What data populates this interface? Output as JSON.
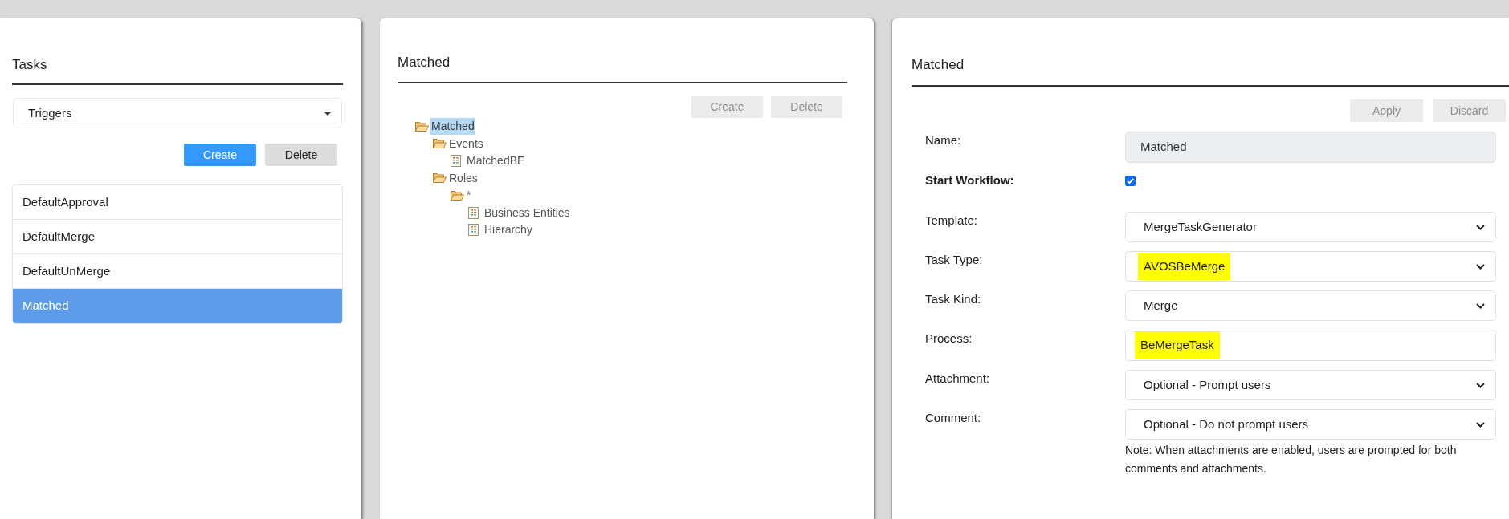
{
  "tasks_panel": {
    "title": "Tasks",
    "dropdown": {
      "value": "Triggers"
    },
    "buttons": [
      {
        "label": "Create",
        "kind": "primary",
        "disabled": false
      },
      {
        "label": "Delete",
        "kind": "secondary",
        "disabled": false
      }
    ],
    "items": [
      {
        "label": "DefaultApproval",
        "selected": false
      },
      {
        "label": "DefaultMerge",
        "selected": false
      },
      {
        "label": "DefaultUnMerge",
        "selected": false
      },
      {
        "label": "Matched",
        "selected": true
      }
    ]
  },
  "tree_panel": {
    "title": "Matched",
    "buttons": [
      {
        "label": "Create",
        "disabled": true
      },
      {
        "label": "Delete",
        "disabled": true
      }
    ],
    "tree": [
      {
        "label": "Matched",
        "kind": "folder",
        "expanded": true,
        "selected": true,
        "children": [
          {
            "label": "Events",
            "kind": "folder",
            "expanded": true,
            "selected": false,
            "children": [
              {
                "label": "MatchedBE",
                "kind": "file",
                "selected": false
              }
            ]
          },
          {
            "label": "Roles",
            "kind": "folder",
            "expanded": true,
            "selected": false,
            "children": [
              {
                "label": "*",
                "kind": "folder",
                "expanded": true,
                "selected": false,
                "children": [
                  {
                    "label": "Business Entities",
                    "kind": "file",
                    "selected": false
                  },
                  {
                    "label": "Hierarchy",
                    "kind": "file",
                    "selected": false
                  }
                ]
              }
            ]
          }
        ]
      }
    ]
  },
  "details_panel": {
    "title": "Matched",
    "buttons": [
      {
        "label": "Apply",
        "disabled": true
      },
      {
        "label": "Discard",
        "disabled": true
      }
    ],
    "fields": [
      {
        "label": "Name:",
        "kind": "text",
        "value": "Matched",
        "disabled": true,
        "highlighted": false
      },
      {
        "label": "Start Workflow:",
        "kind": "checkbox",
        "checked": true,
        "disabled": false,
        "highlighted": false
      },
      {
        "label": "Template:",
        "kind": "select",
        "value": "MergeTaskGenerator",
        "disabled": false,
        "highlighted": false
      },
      {
        "label": "Task Type:",
        "kind": "select",
        "value": "AVOSBeMerge",
        "disabled": false,
        "highlighted": true
      },
      {
        "label": "Task Kind:",
        "kind": "select",
        "value": "Merge",
        "disabled": false,
        "highlighted": false
      },
      {
        "label": "Process:",
        "kind": "text",
        "value": "BeMergeTask",
        "disabled": false,
        "highlighted": true
      },
      {
        "label": "Attachment:",
        "kind": "select",
        "value": "Optional - Prompt users",
        "disabled": false,
        "highlighted": false
      },
      {
        "label": "Comment:",
        "kind": "select",
        "value": "Optional - Do not prompt users",
        "disabled": false,
        "highlighted": false
      }
    ],
    "note": "Note: When attachments are enabled, users are prompted for both comments and attachments."
  }
}
